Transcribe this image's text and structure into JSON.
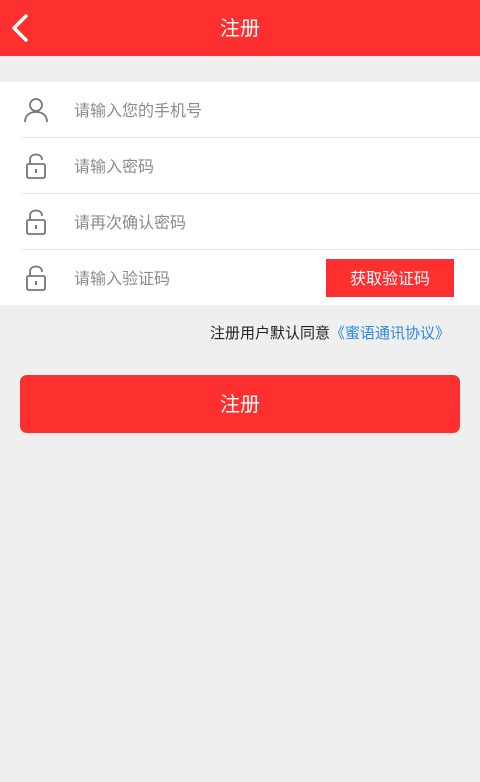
{
  "header": {
    "title": "注册"
  },
  "form": {
    "phone_placeholder": "请输入您的手机号",
    "password_placeholder": "请输入密码",
    "confirm_placeholder": "请再次确认密码",
    "code_placeholder": "请输入验证码",
    "get_code_label": "获取验证码"
  },
  "agreement": {
    "prefix": "注册用户默认同意",
    "link": "《蜜语通讯协议》"
  },
  "register": {
    "label": "注册"
  },
  "colors": {
    "brand_red": "#fe2f2f",
    "link_blue": "#2b89e3"
  },
  "icons": {
    "back": "chevron-left-icon",
    "user": "user-icon",
    "lock": "lock-icon"
  }
}
